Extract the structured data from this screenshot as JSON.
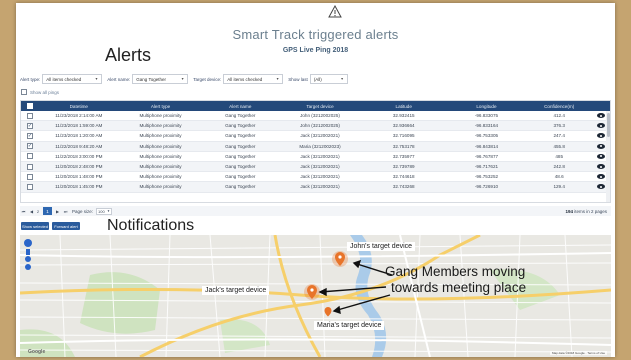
{
  "page": {
    "title": "Smart Track triggered alerts",
    "subtitle": "GPS Live Ping 2018",
    "alerts_heading": "Alerts",
    "notifications_heading": "Notifications",
    "warning_icon": "warning-triangle-icon"
  },
  "filters": {
    "alert_type_label": "Alert type:",
    "alert_type_value": "All items checked",
    "alert_name_label": "Alert name:",
    "alert_name_value": "Gang Together",
    "target_device_label": "Target device:",
    "target_device_value": "All items checked",
    "show_last_label": "Show last",
    "show_last_value": "(All)",
    "show_all_pings": "Show all pings"
  },
  "table": {
    "columns": [
      "Datetime",
      "Alert type",
      "Alert name",
      "Target device",
      "Latitude",
      "Longitude",
      "Confidence(m)"
    ],
    "rows": [
      {
        "checked": false,
        "datetime": "11/23/2018 2:14:00 AM",
        "type": "Multiphone proximity",
        "name": "Gang Together",
        "device": "John (3212002025)",
        "lat": "32.932415",
        "lng": "-96.833075",
        "conf": "412.4"
      },
      {
        "checked": true,
        "datetime": "11/23/2018 1:59:00 AM",
        "type": "Multiphone proximity",
        "name": "Gang Together",
        "device": "John (3212002025)",
        "lat": "32.936664",
        "lng": "-96.833164",
        "conf": "376.3"
      },
      {
        "checked": true,
        "datetime": "11/23/2018 1:20:00 AM",
        "type": "Multiphone proximity",
        "name": "Gang Together",
        "device": "Jack (3212002021)",
        "lat": "32.716095",
        "lng": "-96.753305",
        "conf": "247.4"
      },
      {
        "checked": true,
        "datetime": "11/22/2018 9:48:20 AM",
        "type": "Multiphone proximity",
        "name": "Gang Together",
        "device": "Maria (3212002023)",
        "lat": "32.753178",
        "lng": "-96.843814",
        "conf": "455.8"
      },
      {
        "checked": false,
        "datetime": "11/22/2018 3:00:00 PM",
        "type": "Multiphone proximity",
        "name": "Gang Together",
        "device": "Jack (3212002021)",
        "lat": "32.735977",
        "lng": "-96.767877",
        "conf": "485"
      },
      {
        "checked": false,
        "datetime": "11/20/2018 2:48:00 PM",
        "type": "Multiphone proximity",
        "name": "Gang Together",
        "device": "Jack (3212002021)",
        "lat": "32.739789",
        "lng": "-96.717621",
        "conf": "242.8"
      },
      {
        "checked": false,
        "datetime": "11/20/2018 1:48:00 PM",
        "type": "Multiphone proximity",
        "name": "Gang Together",
        "device": "Jack (3212002021)",
        "lat": "32.744618",
        "lng": "-96.753252",
        "conf": "48.6"
      },
      {
        "checked": false,
        "datetime": "11/20/2018 1:45:00 PM",
        "type": "Multiphone proximity",
        "name": "Gang Together",
        "device": "Jack (3212002021)",
        "lat": "32.743268",
        "lng": "-96.726910",
        "conf": "129.4"
      }
    ]
  },
  "pager": {
    "current_page": "1",
    "page_size_label": "Page size:",
    "page_size_value": "100",
    "items_prefix": "194",
    "items_suffix": "items in 2 pages"
  },
  "buttons": {
    "show_selected": "Show selected",
    "forward_alert": "Forward alert"
  },
  "map": {
    "labels": {
      "john": "John's target device",
      "jack": "Jack's target device",
      "maria": "Maria's target device"
    },
    "callout_line1": "Gang Members moving",
    "callout_line2": "towards meeting place",
    "footer": "Map data ©2018 Google · Terms of Use",
    "google": "Google",
    "pin_color": "#e8742a"
  }
}
